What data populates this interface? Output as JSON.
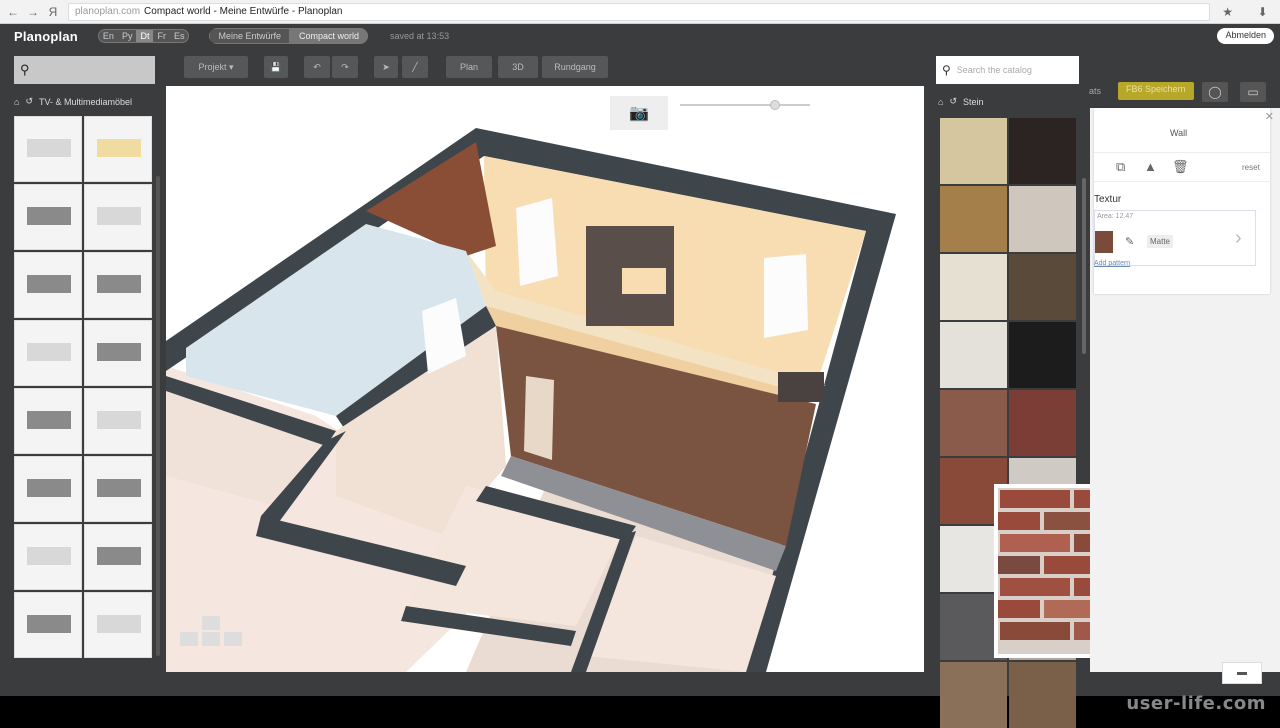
{
  "browser": {
    "url_host": "planoplan.com",
    "page_title": "Compact world - Meine Entwürfe - Planoplan"
  },
  "app": {
    "logo": "Planoplan",
    "languages": [
      "En",
      "Py",
      "Dt",
      "Fr",
      "Es"
    ],
    "active_language": "Dt",
    "breadcrumbs": [
      "Meine Entwürfe",
      "Compact world"
    ],
    "saved_text": "saved at 13:53",
    "logout_label": "Abmelden"
  },
  "toolbar": {
    "project_label": "Projekt",
    "plan_label": "Plan",
    "view3d_label": "3D",
    "walk_label": "Rundgang"
  },
  "left_panel": {
    "category": "TV- & Multimediamöbel",
    "item_count": 16
  },
  "catalog": {
    "search_placeholder": "Search the catalog",
    "category": "Stein",
    "swatch_colors": [
      "#d6c6a0",
      "#2b2422",
      "#a57f4a",
      "#cfc7bd",
      "#e5e0d2",
      "#5a4a3a",
      "#e4e1da",
      "#1c1c1c",
      "#8a5a4a",
      "#7a3e36",
      "#8a4a3a",
      "#cfcac4",
      "#e8e6e2",
      "#c8c4c0",
      "#5a5a5c",
      "#b0a59a",
      "#8a7058",
      "#7a6048"
    ]
  },
  "properties": {
    "fb_button": "FB6 Speichern",
    "section_title": "Wall",
    "reset_label": "reset",
    "texture_heading": "Textur",
    "area_label": "Area: 12.47",
    "matte_label": "Matte",
    "add_pattern_label": "Add pattern"
  },
  "watermark": "user-life.com"
}
